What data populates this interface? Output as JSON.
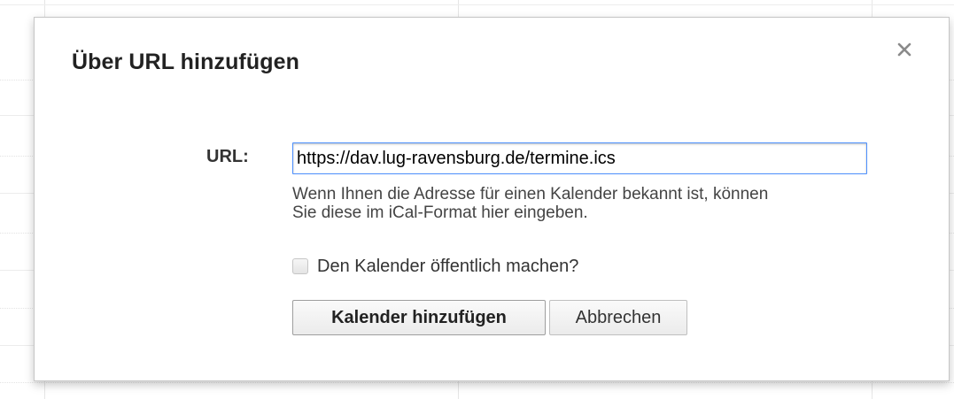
{
  "dialog": {
    "title": "Über URL hinzufügen",
    "close_icon": "close-icon",
    "url_label": "URL:",
    "url_value": "https://dav.lug-ravensburg.de/termine.ics",
    "hint_line1": "Wenn Ihnen die Adresse für einen Kalender bekannt ist, können",
    "hint_line2": "Sie diese im iCal-Format hier eingeben.",
    "public_checkbox": {
      "label": "Den Kalender öffentlich machen?",
      "checked": false
    },
    "add_button_label": "Kalender hinzufügen",
    "cancel_button_label": "Abbrechen"
  },
  "colors": {
    "focus_border": "#4d90fe",
    "title_text": "#222222",
    "hint_text": "#444444"
  }
}
